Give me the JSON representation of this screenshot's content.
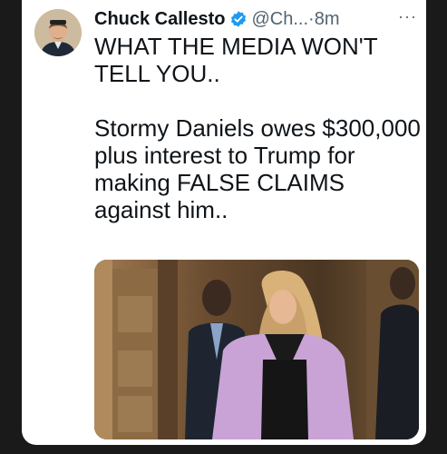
{
  "tweet": {
    "author_name": "Chuck Callesto",
    "handle": "@Ch...",
    "separator": "·",
    "time": "8m",
    "more_label": "···",
    "verified_icon": "verified-badge-icon",
    "text_lines": [
      "WHAT THE MEDIA WON'T TELL YOU..",
      "Stormy Daniels owes $300,000 plus interest to Trump for making FALSE CLAIMS against him.."
    ]
  },
  "colors": {
    "background": "#1a1a1a",
    "card": "#ffffff",
    "text": "#0f1419",
    "secondary_text": "#536471",
    "verified": "#1d9bf0"
  }
}
